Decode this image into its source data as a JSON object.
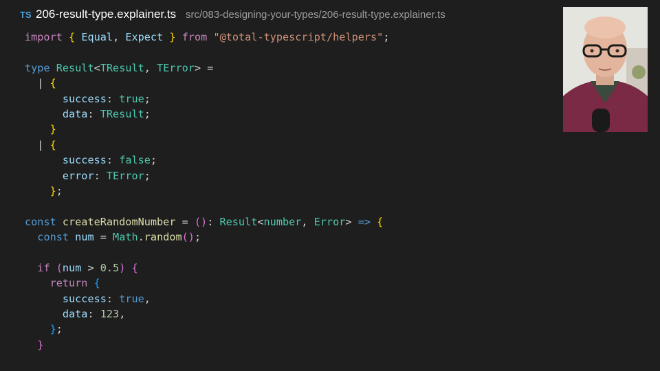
{
  "tab": {
    "lang_badge": "TS",
    "file_name": "206-result-type.explainer.ts",
    "file_path": "src/083-designing-your-types/206-result-type.explainer.ts"
  },
  "code": {
    "lines": [
      [
        [
          "kw2",
          "import"
        ],
        [
          "pl",
          " "
        ],
        [
          "br1",
          "{"
        ],
        [
          "pl",
          " "
        ],
        [
          "prop",
          "Equal"
        ],
        [
          "pl",
          ", "
        ],
        [
          "prop",
          "Expect"
        ],
        [
          "pl",
          " "
        ],
        [
          "br1",
          "}"
        ],
        [
          "pl",
          " "
        ],
        [
          "kw2",
          "from"
        ],
        [
          "pl",
          " "
        ],
        [
          "str",
          "\"@total-typescript/helpers\""
        ],
        [
          "pl",
          ";"
        ]
      ],
      [],
      [
        [
          "kw",
          "type"
        ],
        [
          "pl",
          " "
        ],
        [
          "type",
          "Result"
        ],
        [
          "pl",
          "<"
        ],
        [
          "type",
          "TResult"
        ],
        [
          "pl",
          ", "
        ],
        [
          "type",
          "TError"
        ],
        [
          "pl",
          "> ="
        ]
      ],
      [
        [
          "pl",
          "  | "
        ],
        [
          "br1",
          "{"
        ]
      ],
      [
        [
          "pl",
          "      "
        ],
        [
          "prop",
          "success"
        ],
        [
          "pl",
          ": "
        ],
        [
          "type",
          "true"
        ],
        [
          "pl",
          ";"
        ]
      ],
      [
        [
          "pl",
          "      "
        ],
        [
          "prop",
          "data"
        ],
        [
          "pl",
          ": "
        ],
        [
          "type",
          "TResult"
        ],
        [
          "pl",
          ";"
        ]
      ],
      [
        [
          "pl",
          "    "
        ],
        [
          "br1",
          "}"
        ]
      ],
      [
        [
          "pl",
          "  | "
        ],
        [
          "br1",
          "{"
        ]
      ],
      [
        [
          "pl",
          "      "
        ],
        [
          "prop",
          "success"
        ],
        [
          "pl",
          ": "
        ],
        [
          "type",
          "false"
        ],
        [
          "pl",
          ";"
        ]
      ],
      [
        [
          "pl",
          "      "
        ],
        [
          "prop",
          "error"
        ],
        [
          "pl",
          ": "
        ],
        [
          "type",
          "TError"
        ],
        [
          "pl",
          ";"
        ]
      ],
      [
        [
          "pl",
          "    "
        ],
        [
          "br1",
          "}"
        ],
        [
          "pl",
          ";"
        ]
      ],
      [],
      [
        [
          "kw",
          "const"
        ],
        [
          "pl",
          " "
        ],
        [
          "fn",
          "createRandomNumber"
        ],
        [
          "pl",
          " = "
        ],
        [
          "br2",
          "()"
        ],
        [
          "pl",
          ": "
        ],
        [
          "type",
          "Result"
        ],
        [
          "pl",
          "<"
        ],
        [
          "type",
          "number"
        ],
        [
          "pl",
          ", "
        ],
        [
          "type",
          "Error"
        ],
        [
          "pl",
          "> "
        ],
        [
          "kw",
          "=>"
        ],
        [
          "pl",
          " "
        ],
        [
          "br1",
          "{"
        ]
      ],
      [
        [
          "pl",
          "  "
        ],
        [
          "kw",
          "const"
        ],
        [
          "pl",
          " "
        ],
        [
          "prop",
          "num"
        ],
        [
          "pl",
          " = "
        ],
        [
          "type",
          "Math"
        ],
        [
          "pl",
          "."
        ],
        [
          "fn",
          "random"
        ],
        [
          "br2",
          "()"
        ],
        [
          "pl",
          ";"
        ]
      ],
      [],
      [
        [
          "pl",
          "  "
        ],
        [
          "kw2",
          "if"
        ],
        [
          "pl",
          " "
        ],
        [
          "br2",
          "("
        ],
        [
          "prop",
          "num"
        ],
        [
          "pl",
          " > "
        ],
        [
          "num",
          "0.5"
        ],
        [
          "br2",
          ")"
        ],
        [
          "pl",
          " "
        ],
        [
          "br2",
          "{"
        ]
      ],
      [
        [
          "pl",
          "    "
        ],
        [
          "kw2",
          "return"
        ],
        [
          "pl",
          " "
        ],
        [
          "br3",
          "{"
        ]
      ],
      [
        [
          "pl",
          "      "
        ],
        [
          "prop",
          "success"
        ],
        [
          "pl",
          ": "
        ],
        [
          "kw",
          "true"
        ],
        [
          "pl",
          ","
        ]
      ],
      [
        [
          "pl",
          "      "
        ],
        [
          "prop",
          "data"
        ],
        [
          "pl",
          ": "
        ],
        [
          "num",
          "123"
        ],
        [
          "pl",
          ","
        ]
      ],
      [
        [
          "pl",
          "    "
        ],
        [
          "br3",
          "}"
        ],
        [
          "pl",
          ";"
        ]
      ],
      [
        [
          "pl",
          "  "
        ],
        [
          "br2",
          "}"
        ]
      ]
    ]
  },
  "colors": {
    "editor_background": "#1e1e1e",
    "keyword": "#569cd6",
    "control_keyword": "#c586c0",
    "type": "#4ec9b0",
    "property": "#9cdcfe",
    "function": "#dcdcaa",
    "string": "#ce9178",
    "number": "#b5cea8"
  }
}
